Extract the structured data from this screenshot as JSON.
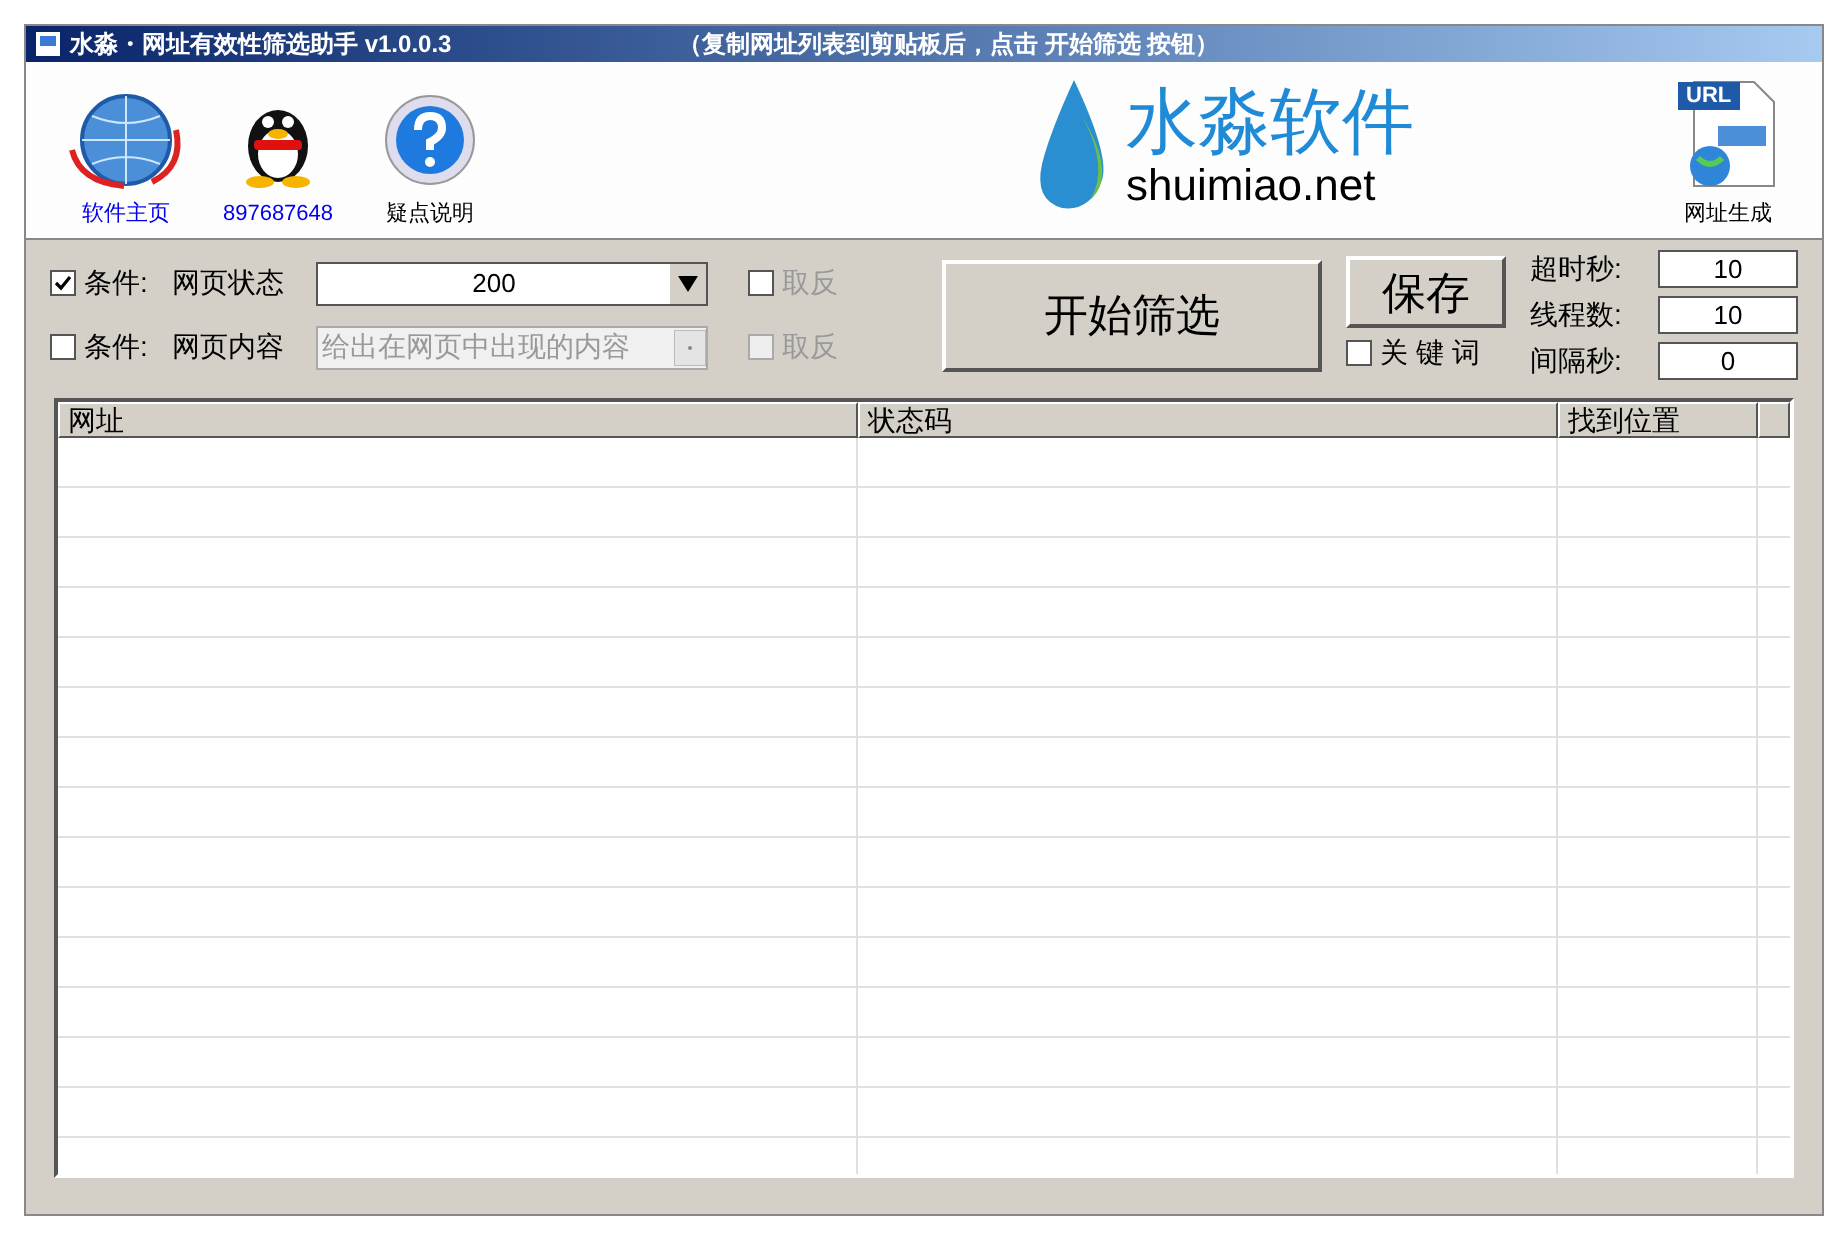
{
  "window": {
    "title": "水淼・网址有效性筛选助手 v1.0.0.3",
    "hint": "（复制网址列表到剪贴板后，点击 开始筛选 按钮）"
  },
  "toolbar": [
    {
      "label": "软件主页",
      "kind": "globe",
      "link": true
    },
    {
      "label": "897687648",
      "kind": "penguin",
      "link": true
    },
    {
      "label": "疑点说明",
      "kind": "help",
      "link": false
    }
  ],
  "logo": {
    "name": "水淼软件",
    "domain": "shuimiao.net"
  },
  "url_tool": {
    "label": "网址生成",
    "badge": "URL"
  },
  "conditions": [
    {
      "kind": "select",
      "checked": true,
      "prefix": "条件:",
      "label": "网页状态",
      "value": "200",
      "invert_label": "取反",
      "invert_checked": false,
      "disabled": false
    },
    {
      "kind": "input",
      "checked": false,
      "prefix": "条件:",
      "label": "网页内容",
      "placeholder": "给出在网页中出现的内容",
      "invert_label": "取反",
      "invert_checked": false,
      "disabled": true
    }
  ],
  "start_button": "开始筛选",
  "save_button": "保存",
  "keyword": {
    "label": "关 键 词",
    "checked": false
  },
  "settings": [
    {
      "label": "超时秒:",
      "value": "10"
    },
    {
      "label": "线程数:",
      "value": "10"
    },
    {
      "label": "间隔秒:",
      "value": "0"
    }
  ],
  "table": {
    "columns": [
      "网址",
      "状态码",
      "找到位置"
    ]
  }
}
